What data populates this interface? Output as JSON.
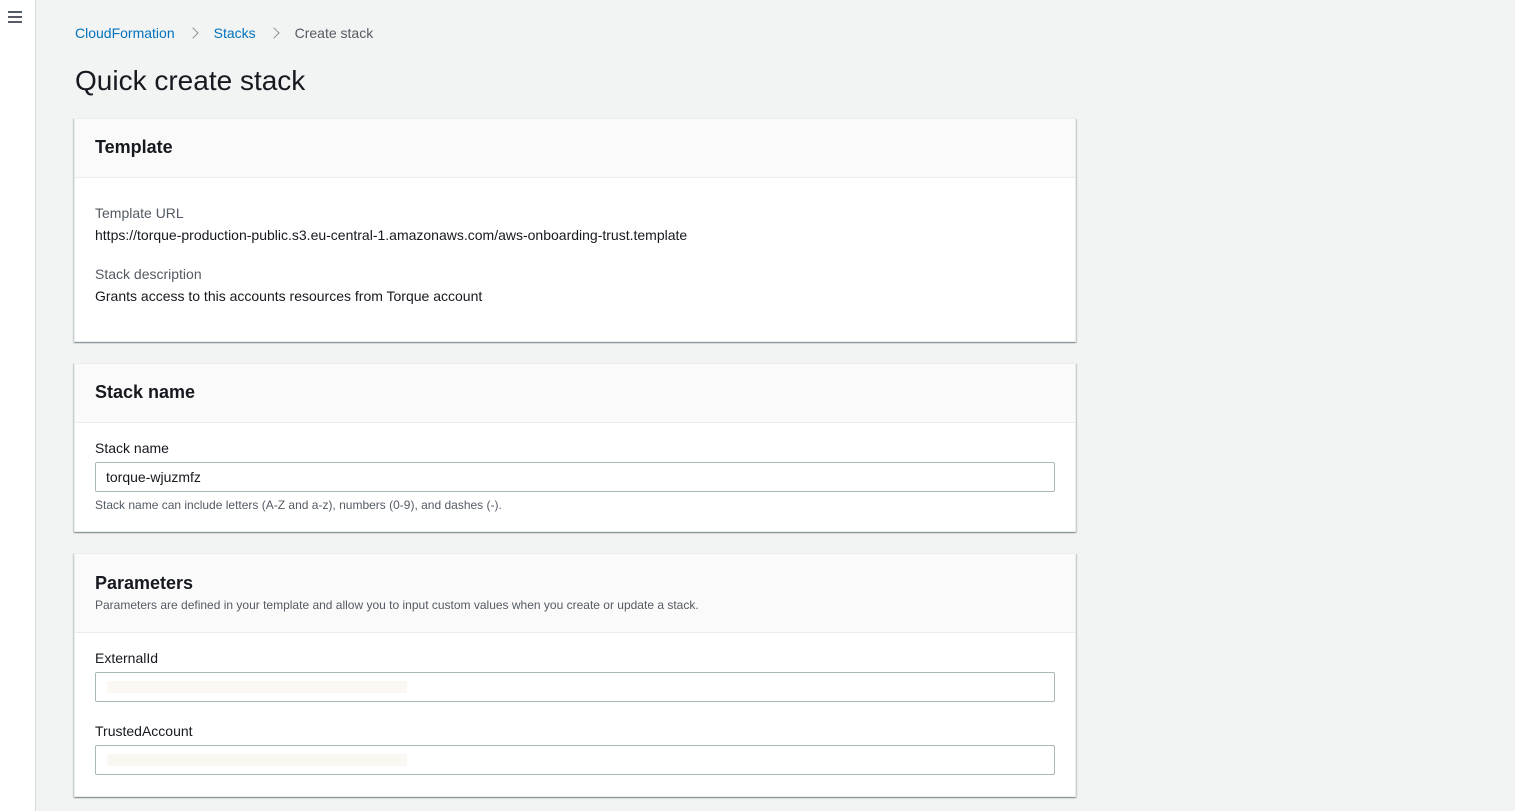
{
  "breadcrumb": {
    "items": [
      {
        "label": "CloudFormation"
      },
      {
        "label": "Stacks"
      }
    ],
    "current": "Create stack"
  },
  "page": {
    "title": "Quick create stack"
  },
  "template_panel": {
    "title": "Template",
    "url_label": "Template URL",
    "url_value": "https://torque-production-public.s3.eu-central-1.amazonaws.com/aws-onboarding-trust.template",
    "description_label": "Stack description",
    "description_value": "Grants access to this accounts resources from Torque account"
  },
  "stack_name_panel": {
    "title": "Stack name",
    "field_label": "Stack name",
    "field_value": "torque-wjuzmfz",
    "hint": "Stack name can include letters (A-Z and a-z), numbers (0-9), and dashes (-)."
  },
  "parameters_panel": {
    "title": "Parameters",
    "description": "Parameters are defined in your template and allow you to input custom values when you create or update a stack.",
    "external_id_label": "ExternalId",
    "external_id_value": "",
    "trusted_account_label": "TrustedAccount",
    "trusted_account_value": ""
  },
  "icons": {
    "menu": "hamburger-menu-icon",
    "separator": "chevron-right-icon"
  }
}
